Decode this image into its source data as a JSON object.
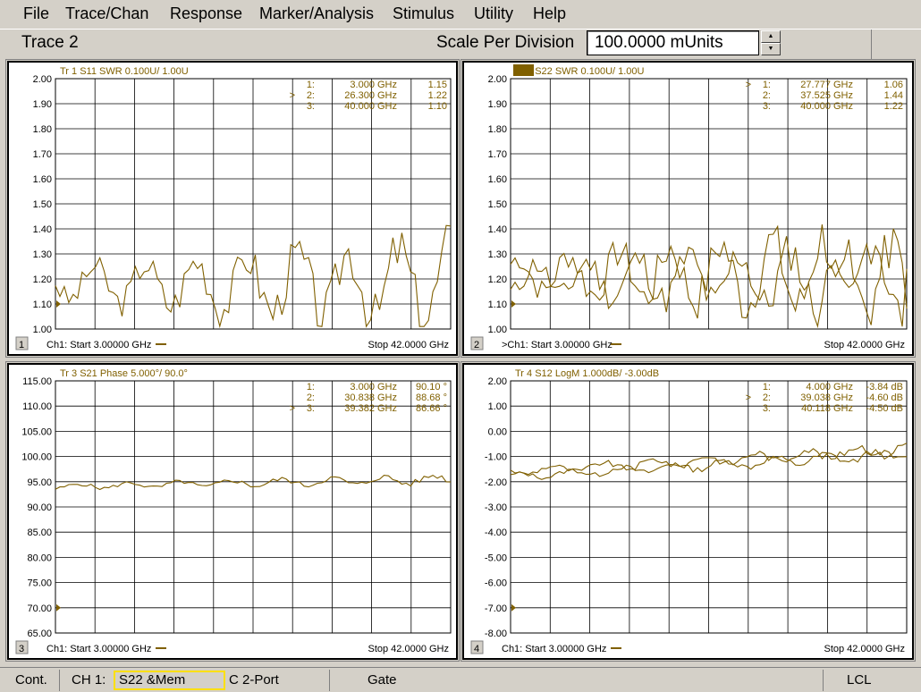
{
  "menu": [
    "File",
    "Trace/Chan",
    "Response",
    "Marker/Analysis",
    "Stimulus",
    "Utility",
    "Help"
  ],
  "toolbar": {
    "active_trace": "Trace 2",
    "scale_label": "Scale Per Division",
    "scale_value": "100.0000 mUnits"
  },
  "trace_color": "#806000",
  "panels": [
    {
      "id": "1",
      "header": "Tr 1  S11 SWR 0.100U/  1.00U",
      "header_active": false,
      "yticks": [
        "2.00",
        "1.90",
        "1.80",
        "1.70",
        "1.60",
        "1.50",
        "1.40",
        "1.30",
        "1.20",
        "1.10",
        "1.00"
      ],
      "markers": [
        {
          "sel": "",
          "num": "1:",
          "freq": "3.000 GHz",
          "val": "1.15"
        },
        {
          "sel": ">",
          "num": "2:",
          "freq": "26.300 GHz",
          "val": "1.22"
        },
        {
          "sel": "",
          "num": "3:",
          "freq": "40.000 GHz",
          "val": "1.10"
        }
      ],
      "channel": "1",
      "start": "Ch1: Start  3.00000 GHz",
      "stop": "Stop  42.0000 GHz"
    },
    {
      "id": "2",
      "header": "Tr 2  S22 SWR 0.100U/  1.00U",
      "header_active": true,
      "yticks": [
        "2.00",
        "1.90",
        "1.80",
        "1.70",
        "1.60",
        "1.50",
        "1.40",
        "1.30",
        "1.20",
        "1.10",
        "1.00"
      ],
      "markers": [
        {
          "sel": ">",
          "num": "1:",
          "freq": "27.777 GHz",
          "val": "1.06"
        },
        {
          "sel": "",
          "num": "2:",
          "freq": "37.525 GHz",
          "val": "1.44"
        },
        {
          "sel": "",
          "num": "3:",
          "freq": "40.000 GHz",
          "val": "1.22"
        }
      ],
      "channel": "2",
      "start": ">Ch1: Start  3.00000 GHz",
      "stop": "Stop  42.0000 GHz"
    },
    {
      "id": "3",
      "header": "Tr 3  S21 Phase 5.000°/  90.0°",
      "header_active": false,
      "yticks": [
        "115.00",
        "110.00",
        "105.00",
        "100.00",
        "95.00",
        "90.00",
        "85.00",
        "80.00",
        "75.00",
        "70.00",
        "65.00"
      ],
      "markers": [
        {
          "sel": "",
          "num": "1:",
          "freq": "3.000 GHz",
          "val": "90.10 °"
        },
        {
          "sel": "",
          "num": "2:",
          "freq": "30.838 GHz",
          "val": "88.68 °"
        },
        {
          "sel": ">",
          "num": "3:",
          "freq": "39.382 GHz",
          "val": "86.66 °"
        }
      ],
      "channel": "3",
      "start": "Ch1: Start  3.00000 GHz",
      "stop": "Stop  42.0000 GHz"
    },
    {
      "id": "4",
      "header": "Tr 4  S12 LogM 1.000dB/  -3.00dB",
      "header_active": false,
      "yticks": [
        "2.00",
        "1.00",
        "0.00",
        "-1.00",
        "-2.00",
        "-3.00",
        "-4.00",
        "-5.00",
        "-6.00",
        "-7.00",
        "-8.00"
      ],
      "markers": [
        {
          "sel": "",
          "num": "1:",
          "freq": "4.000 GHz",
          "val": "-3.84 dB"
        },
        {
          "sel": ">",
          "num": "2:",
          "freq": "39.038 GHz",
          "val": "-4.60 dB"
        },
        {
          "sel": "",
          "num": "3:",
          "freq": "40.118 GHz",
          "val": "-4.50 dB"
        }
      ],
      "channel": "4",
      "start": "Ch1: Start  3.00000 GHz",
      "stop": "Stop  42.0000 GHz"
    }
  ],
  "status": {
    "mode": "Cont.",
    "channel": "CH 1:",
    "measurement": "S22 &Mem",
    "cal": "C  2-Port",
    "gate": "Gate",
    "remote": "LCL"
  }
}
